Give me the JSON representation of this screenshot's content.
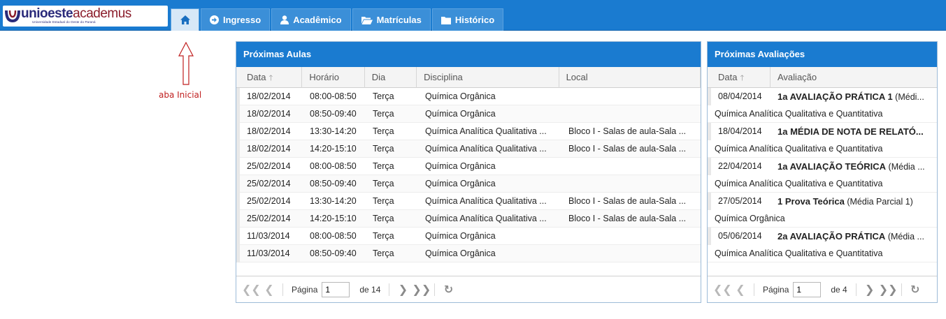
{
  "logo": {
    "part1": "unioeste",
    "part2": "academus",
    "subtitle": "Universidade Estadual do Oeste do Paraná"
  },
  "nav": {
    "home_icon": "home-icon",
    "tabs": [
      {
        "label": "Ingresso",
        "icon": "arrow-circle-right-icon"
      },
      {
        "label": "Acadêmico",
        "icon": "user-icon"
      },
      {
        "label": "Matrículas",
        "icon": "folder-open-icon"
      },
      {
        "label": "Histórico",
        "icon": "folder-icon"
      }
    ]
  },
  "annotation": {
    "text": "aba Inicial",
    "color": "#c02020"
  },
  "aulas": {
    "title": "Próximas Aulas",
    "columns": [
      "Data",
      "Horário",
      "Dia",
      "Disciplina",
      "Local"
    ],
    "rows": [
      [
        "18/02/2014",
        "08:00-08:50",
        "Terça",
        "Química Orgânica",
        ""
      ],
      [
        "18/02/2014",
        "08:50-09:40",
        "Terça",
        "Química Orgânica",
        ""
      ],
      [
        "18/02/2014",
        "13:30-14:20",
        "Terça",
        "Química Analítica Qualitativa ...",
        "Bloco I - Salas de aula-Sala ..."
      ],
      [
        "18/02/2014",
        "14:20-15:10",
        "Terça",
        "Química Analítica Qualitativa ...",
        "Bloco I - Salas de aula-Sala ..."
      ],
      [
        "25/02/2014",
        "08:00-08:50",
        "Terça",
        "Química Orgânica",
        ""
      ],
      [
        "25/02/2014",
        "08:50-09:40",
        "Terça",
        "Química Orgânica",
        ""
      ],
      [
        "25/02/2014",
        "13:30-14:20",
        "Terça",
        "Química Analítica Qualitativa ...",
        "Bloco I - Salas de aula-Sala ..."
      ],
      [
        "25/02/2014",
        "14:20-15:10",
        "Terça",
        "Química Analítica Qualitativa ...",
        "Bloco I - Salas de aula-Sala ..."
      ],
      [
        "11/03/2014",
        "08:00-08:50",
        "Terça",
        "Química Orgânica",
        ""
      ],
      [
        "11/03/2014",
        "08:50-09:40",
        "Terça",
        "Química Orgânica",
        ""
      ]
    ],
    "pager": {
      "page_label": "Página",
      "page_value": "1",
      "of_label": "de 14"
    }
  },
  "avaliacoes": {
    "title": "Próximas Avaliações",
    "columns": [
      "Data",
      "Avaliação"
    ],
    "rows": [
      {
        "date": "08/04/2014",
        "name": "1a AVALIAÇÃO PRÁTICA 1",
        "detail": "(Médi...",
        "subject": "Química Analítica Qualitativa e Quantitativa"
      },
      {
        "date": "18/04/2014",
        "name": "1a MÉDIA DE NOTA DE RELATÓ...",
        "detail": "",
        "subject": "Química Analítica Qualitativa e Quantitativa"
      },
      {
        "date": "22/04/2014",
        "name": "1a AVALIAÇÃO TEÓRICA",
        "detail": "(Média ...",
        "subject": "Química Analítica Qualitativa e Quantitativa"
      },
      {
        "date": "27/05/2014",
        "name": "1 Prova Teórica",
        "detail": "(Média Parcial 1)",
        "subject": "Química Orgânica"
      },
      {
        "date": "05/06/2014",
        "name": "2a AVALIAÇÃO PRÁTICA",
        "detail": "(Média ...",
        "subject": "Química Analítica Qualitativa e Quantitativa"
      }
    ],
    "pager": {
      "page_label": "Página",
      "page_value": "1",
      "of_label": "de 4"
    }
  }
}
